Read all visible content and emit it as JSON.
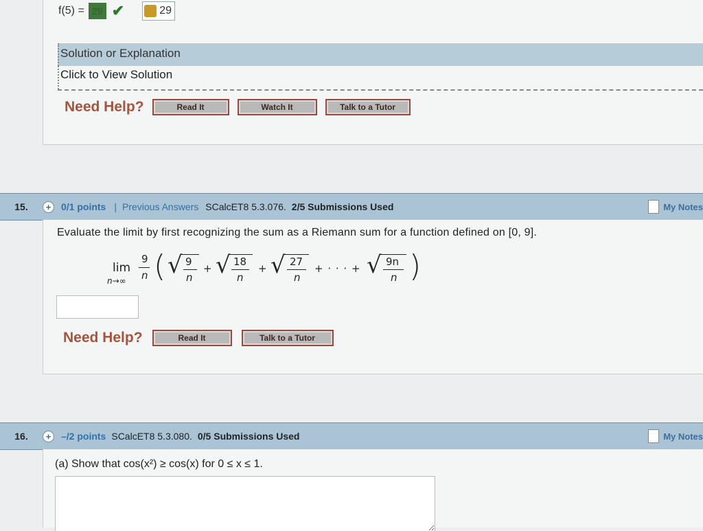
{
  "prev_question": {
    "fx_label": "f(5) =",
    "answer_box": "29",
    "key_answer": "29",
    "solution_title": "Solution or Explanation",
    "solution_link": "Click to View Solution",
    "help_label": "Need Help?",
    "buttons": [
      "Read It",
      "Watch It",
      "Talk to a Tutor"
    ]
  },
  "q15": {
    "number": "15.",
    "points": "0/1 points",
    "separator": "|",
    "previous_answers": "Previous Answers",
    "code": "SCalcET8 5.3.076.",
    "submissions": "2/5 Submissions Used",
    "my_notes": "My Notes",
    "prompt": "Evaluate the limit by first recognizing the sum as a Riemann sum for a function defined on [0, 9].",
    "math": {
      "lim": "lim",
      "sub": "n→∞",
      "coef_num": "9",
      "coef_den": "n",
      "terms": [
        {
          "num": "9",
          "den": "n"
        },
        {
          "num": "18",
          "den": "n"
        },
        {
          "num": "27",
          "den": "n"
        },
        {
          "num": "9n",
          "den": "n"
        }
      ],
      "plus": "+",
      "ellipsis": "+ · · · +"
    },
    "answer_value": "",
    "help_label": "Need Help?",
    "buttons": [
      "Read It",
      "Talk to a Tutor"
    ]
  },
  "q16": {
    "number": "16.",
    "points": "–/2 points",
    "code": "SCalcET8 5.3.080.",
    "submissions": "0/5 Submissions Used",
    "my_notes": "My Notes",
    "prompt": "(a) Show that cos(x²) ≥ cos(x) for 0 ≤ x ≤ 1."
  },
  "colors": {
    "header_bg": "#aac4d6",
    "link_blue": "#3170a8",
    "help_red": "#a8533a",
    "solution_bar": "#b7ccd9"
  }
}
